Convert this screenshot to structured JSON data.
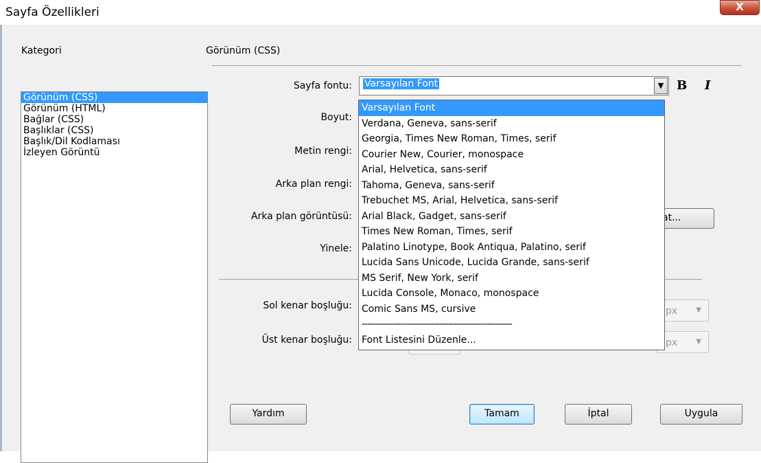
{
  "window": {
    "title": "Sayfa Özellikleri",
    "close_label": "X"
  },
  "category": {
    "label": "Kategori",
    "items": [
      "Görünüm (CSS)",
      "Görünüm (HTML)",
      "Bağlar (CSS)",
      "Başlıklar (CSS)",
      "Başlık/Dil Kodlaması",
      "İzleyen Görüntü"
    ],
    "selected_index": 0
  },
  "section": {
    "title": "Görünüm (CSS)"
  },
  "form": {
    "page_font_label": "Sayfa fontu:",
    "page_font_value": "Varsayılan Font",
    "bold_label": "B",
    "italic_label": "I",
    "size_label": "Boyut:",
    "text_color_label": "Metin rengi:",
    "bg_color_label": "Arka plan rengi:",
    "bg_image_label": "Arka plan görüntüsü:",
    "browse_label_visible": "at...",
    "repeat_label": "Yinele:",
    "left_margin_label": "Sol kenar boşluğu:",
    "top_margin_label": "Üst kenar boşluğu:",
    "unit_value": "px"
  },
  "font_dropdown": {
    "options": [
      "Varsayılan Font",
      "Verdana, Geneva, sans-serif",
      "Georgia, Times New Roman, Times, serif",
      "Courier New, Courier, monospace",
      "Arial, Helvetica, sans-serif",
      "Tahoma, Geneva, sans-serif",
      "Trebuchet MS, Arial, Helvetica, sans-serif",
      "Arial Black, Gadget, sans-serif",
      "Times New Roman, Times, serif",
      "Palatino Linotype, Book Antiqua, Palatino, serif",
      "Lucida Sans Unicode, Lucida Grande, sans-serif",
      "MS Serif, New York, serif",
      "Lucida Console, Monaco, monospace",
      "Comic Sans MS, cursive",
      "------------------------------------------------------",
      "Font Listesini Düzenle..."
    ],
    "selected_index": 0
  },
  "buttons": {
    "help": "Yardım",
    "ok": "Tamam",
    "cancel": "İptal",
    "apply": "Uygula"
  },
  "colors": {
    "selection": "#3399ff",
    "dialog_bg": "#f0f0f0",
    "close_red": "#c9513a"
  }
}
